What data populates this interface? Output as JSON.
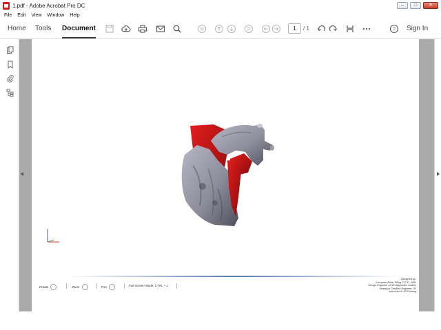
{
  "window": {
    "title": "1.pdf - Adobe Acrobat Pro DC"
  },
  "menu": [
    "File",
    "Edit",
    "View",
    "Window",
    "Help"
  ],
  "toolbar": {
    "tabs": [
      {
        "label": "Home"
      },
      {
        "label": "Tools"
      },
      {
        "label": "Document"
      }
    ],
    "page_current": "1",
    "page_total": "/ 1",
    "sign_in": "Sign In",
    "icons": [
      "save-icon",
      "upload-cloud-icon",
      "print-icon",
      "email-icon",
      "search-icon",
      "prev-page-icon",
      "page-up-icon",
      "page-down-icon",
      "fit-icon",
      "back-icon",
      "forward-icon",
      "rotate-ccw-icon",
      "rotate-cw-icon",
      "select-icon",
      "more-icon",
      "help-icon"
    ]
  },
  "document": {
    "controls": [
      {
        "label": "Rotate"
      },
      {
        "label": "Zoom"
      },
      {
        "label": "Pan"
      },
      {
        "label": "Full Screen Mode:  CTRL + L"
      }
    ],
    "credits": [
      "Designed by:",
      "Leonardo Bihai, BEng C.E.E., MSc",
      "Design Engineer of 3D diagnostic models",
      "Stratasys Certified Engineer, 3F",
      "Instructor in 3D Printing"
    ]
  }
}
